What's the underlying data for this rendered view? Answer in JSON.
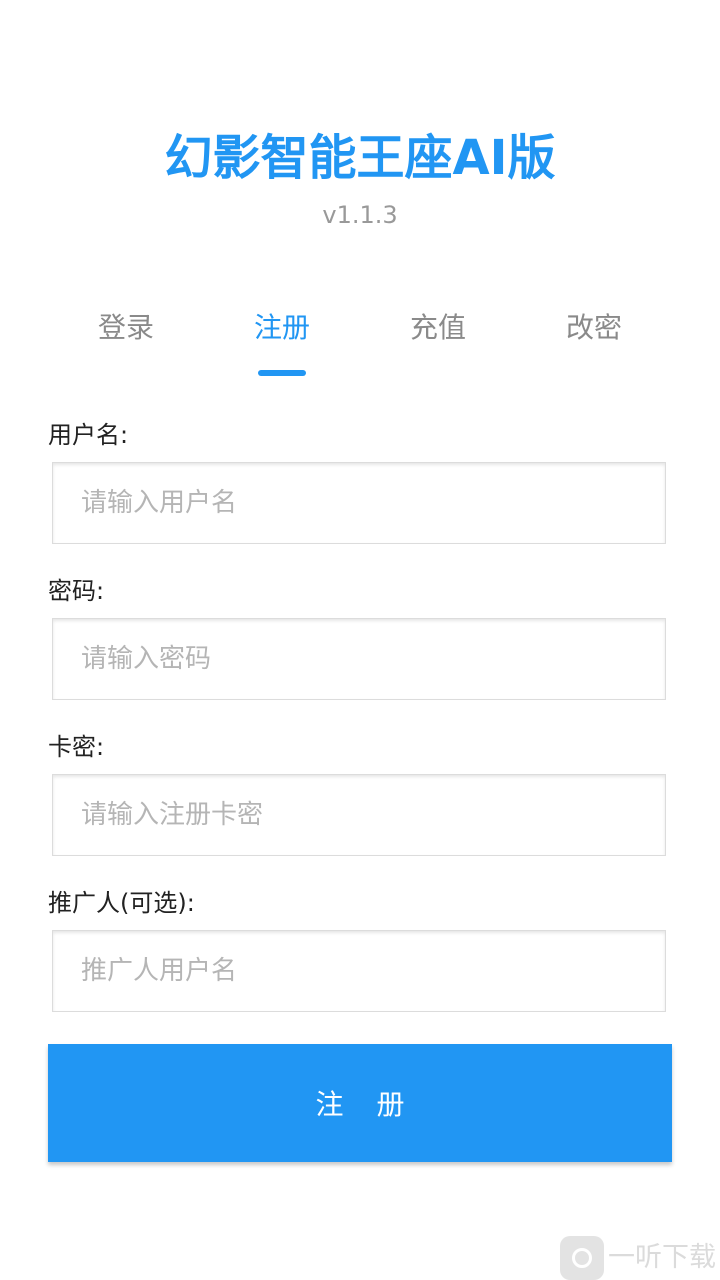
{
  "header": {
    "title": "幻影智能王座AI版",
    "version": "v1.1.3"
  },
  "tabs": [
    {
      "label": "登录",
      "active": false
    },
    {
      "label": "注册",
      "active": true
    },
    {
      "label": "充值",
      "active": false
    },
    {
      "label": "改密",
      "active": false
    }
  ],
  "form": {
    "username": {
      "label": "用户名:",
      "placeholder": "请输入用户名",
      "value": ""
    },
    "password": {
      "label": "密码:",
      "placeholder": "请输入密码",
      "value": ""
    },
    "card_key": {
      "label": "卡密:",
      "placeholder": "请输入注册卡密",
      "value": ""
    },
    "referrer": {
      "label": "推广人(可选):",
      "placeholder": "推广人用户名",
      "value": ""
    },
    "submit_label": "注 册"
  },
  "watermark": {
    "text": "一听下载",
    "icon": "yiting-logo-icon"
  },
  "colors": {
    "accent": "#2196f3",
    "tab_inactive": "#8a8a8a",
    "placeholder": "#b5b5b5"
  }
}
